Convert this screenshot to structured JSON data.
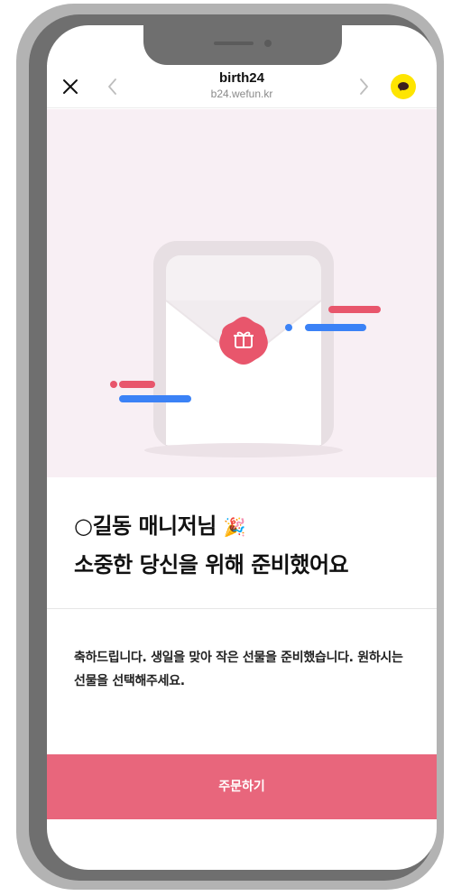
{
  "browser": {
    "site_title": "birth24",
    "site_url": "b24.wefun.kr"
  },
  "icons": {
    "close": "close-icon",
    "back": "chevron-left-icon",
    "forward": "chevron-right-icon",
    "kakao": "kakaotalk-icon",
    "party": "party-popper-icon",
    "gift": "gift-icon"
  },
  "content": {
    "headline_line1": "○길동 매니저님",
    "party_emoji": "🎉",
    "headline_line2": "소중한 당신을 위해 준비했어요",
    "message": "축하드립니다. 생일을 맞아 작은 선물을 준비했습니다. 원하시는 선물을 선택해주세요."
  },
  "actions": {
    "order_label": "주문하기"
  },
  "colors": {
    "accent": "#e8667c",
    "hero_bg": "#f8eff4",
    "kakao_yellow": "#fee500",
    "blue_line": "#3b82f6",
    "red_line": "#e8566c"
  }
}
